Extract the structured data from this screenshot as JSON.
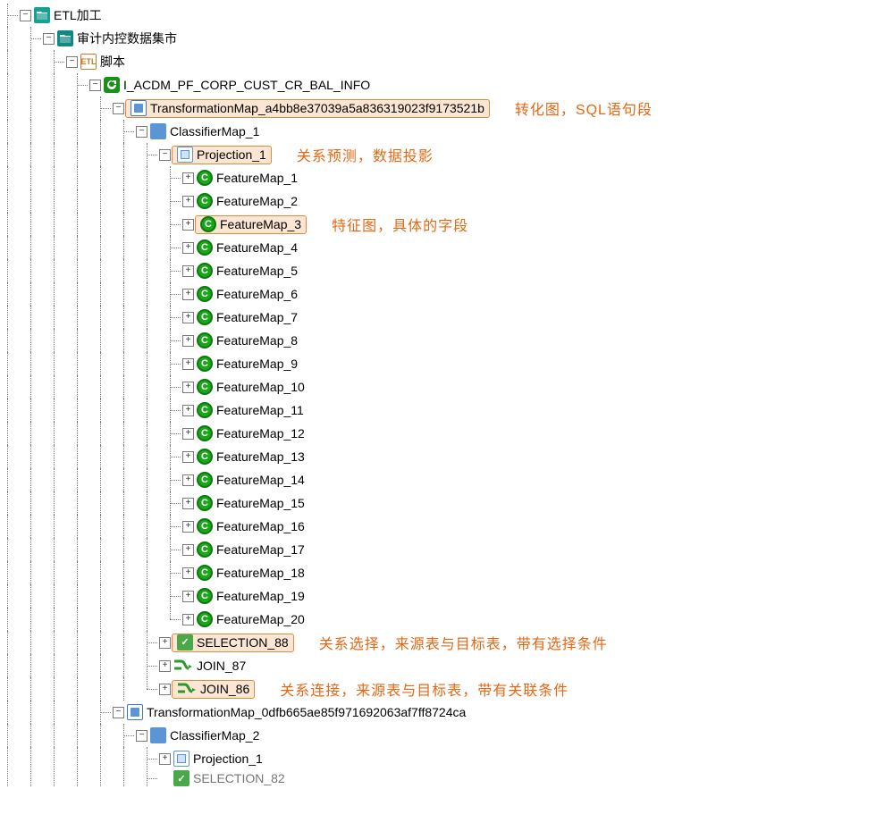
{
  "tree": {
    "root": "ETL加工",
    "child1": "审计内控数据集市",
    "child2": "脚本",
    "child3": "I_ACDM_PF_CORP_CUST_CR_BAL_INFO",
    "tmap1": "TransformationMap_a4bb8e37039a5a836319023f9173521b",
    "cmap1": "ClassifierMap_1",
    "proj1": "Projection_1",
    "features": [
      "FeatureMap_1",
      "FeatureMap_2",
      "FeatureMap_3",
      "FeatureMap_4",
      "FeatureMap_5",
      "FeatureMap_6",
      "FeatureMap_7",
      "FeatureMap_8",
      "FeatureMap_9",
      "FeatureMap_10",
      "FeatureMap_11",
      "FeatureMap_12",
      "FeatureMap_13",
      "FeatureMap_14",
      "FeatureMap_15",
      "FeatureMap_16",
      "FeatureMap_17",
      "FeatureMap_18",
      "FeatureMap_19",
      "FeatureMap_20"
    ],
    "sel88": "SELECTION_88",
    "join87": "JOIN_87",
    "join86": "JOIN_86",
    "tmap2": "TransformationMap_0dfb665ae85f971692063af7ff8724ca",
    "cmap2": "ClassifierMap_2",
    "proj2": "Projection_1",
    "sel82": "SELECTION_82"
  },
  "annotations": {
    "tmap": "转化图，SQL语句段",
    "proj": "关系预测，数据投影",
    "feat": "特征图，具体的字段",
    "sel": "关系选择，来源表与目标表，带有选择条件",
    "join": "关系连接，来源表与目标表，带有关联条件"
  },
  "toggle": {
    "minus": "−",
    "plus": "+"
  }
}
